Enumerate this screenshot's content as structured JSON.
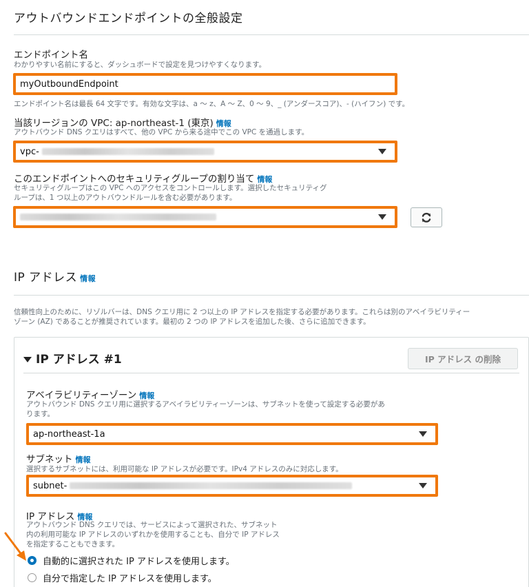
{
  "general": {
    "title": "アウトバウンドエンドポイントの全般設定",
    "name_label": "エンドポイント名",
    "name_desc": "わかりやすい名前にすると、ダッシュボードで設定を見つけやすくなります。",
    "name_value": "myOutboundEndpoint",
    "name_hint": "エンドポイント名は最長 64 文字です。有効な文字は、a ～ z、A ～ Z、0 ～ 9、_ (アンダースコア)、- (ハイフン) です。",
    "vpc_label": "当該リージョンの VPC: ap-northeast-1 (東京)",
    "vpc_info": "情報",
    "vpc_desc": "アウトバウンド DNS クエリはすべて、他の VPC から来る途中でこの VPC を通過します。",
    "vpc_value": "vpc-",
    "sg_label": "このエンドポイントへのセキュリティグループの割り当て",
    "sg_info": "情報",
    "sg_desc1": "セキュリティグループはこの VPC へのアクセスをコントロールします。選択したセキュリティグ",
    "sg_desc2": "ループは、1 つ以上のアウトバウンドルールを含む必要があります。"
  },
  "ip": {
    "title": "IP アドレス",
    "info": "情報",
    "desc1": "信頼性向上のために、リゾルバーは、DNS クエリ用に 2 つ以上の IP アドレスを指定する必要があります。これらは別のアベイラビリティー",
    "desc2": "ゾーン (AZ) であることが推奨されています。最初の 2 つの IP アドレスを追加した後、さらに追加できます。",
    "panel": {
      "title": "IP アドレス #1",
      "remove_label": "IP アドレス の削除",
      "az_label": "アベイラビリティーゾーン",
      "az_info": "情報",
      "az_desc1": "アウトバウンド DNS クエリ用に選択するアベイラビリティーゾーンは、サブネットを使って設定する必要があ",
      "az_desc2": "ります。",
      "az_value": "ap-northeast-1a",
      "subnet_label": "サブネット",
      "subnet_info": "情報",
      "subnet_desc": "選択するサブネットには、利用可能な IP アドレスが必要です。IPv4 アドレスのみに対応します。",
      "subnet_value": "subnet-",
      "ipaddr_label": "IP アドレス",
      "ipaddr_info": "情報",
      "ipaddr_desc1": "アウトバウンド DNS クエリでは、サービスによって選択された、サブネット",
      "ipaddr_desc2": "内の利用可能な IP アドレスのいずれかを使用することも、自分で IP アドレス",
      "ipaddr_desc3": "を指定することもできます。",
      "radio_auto": "自動的に選択された IP アドレスを使用します。",
      "radio_manual": "自分で指定した IP アドレスを使用します。",
      "selected": "auto"
    }
  },
  "colors": {
    "highlight": "#f0780a",
    "link": "#0073bb",
    "arrow": "#f0780a"
  },
  "icons": [
    "refresh-icon",
    "caret-down-icon",
    "collapse-triangle-icon",
    "annotation-arrow-icon"
  ]
}
